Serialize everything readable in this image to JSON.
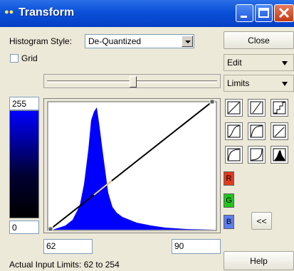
{
  "window": {
    "title": "Transform",
    "title_icon": "rgb-glasses-icon"
  },
  "controls": {
    "histogram_style_label": "Histogram Style:",
    "histogram_style_value": "De-Quantized",
    "grid_label": "Grid"
  },
  "intensity": {
    "top": "255",
    "bottom": "0"
  },
  "range": {
    "min": "62",
    "max": "90"
  },
  "status": "Actual Input Limits: 62 to 254",
  "side": {
    "close_label": "Close",
    "edit_label": "Edit",
    "limits_label": "Limits",
    "help_label": "Help",
    "collapse_label": "<<"
  },
  "channels": [
    {
      "label": "R",
      "color": "#e03a1e"
    },
    {
      "label": "G",
      "color": "#22c41e"
    },
    {
      "label": "B",
      "color": "#5c7ef0"
    }
  ],
  "curve_buttons": [
    {
      "name": "linear-curve-icon"
    },
    {
      "name": "linear-alt-curve-icon"
    },
    {
      "name": "step-curve-icon"
    },
    {
      "name": "s-curve-icon"
    },
    {
      "name": "log-curve-icon"
    },
    {
      "name": "clip-curve-icon"
    },
    {
      "name": "sqrt-curve-icon"
    },
    {
      "name": "exp-curve-icon"
    },
    {
      "name": "histogram-eq-icon"
    }
  ],
  "colors": {
    "titlebar": "#0a4fd8",
    "histogram": "#0000ff",
    "curve_highlight": "#f0d878"
  }
}
